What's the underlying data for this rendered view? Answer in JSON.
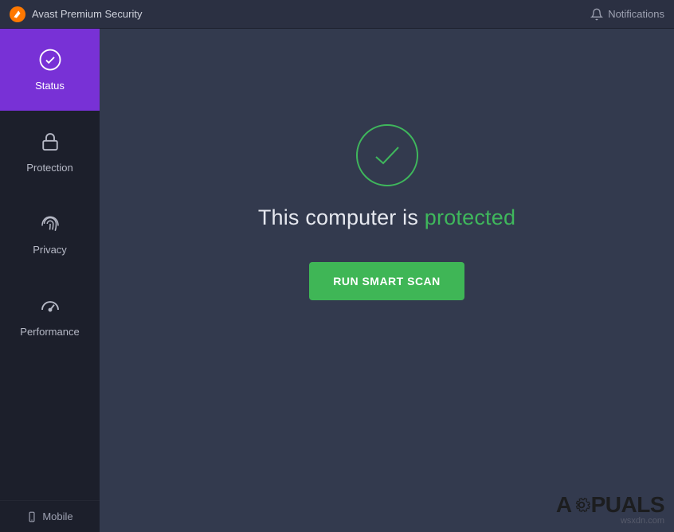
{
  "titlebar": {
    "app_title": "Avast Premium Security",
    "notifications_label": "Notifications"
  },
  "sidebar": {
    "items": [
      {
        "label": "Status",
        "active": true
      },
      {
        "label": "Protection",
        "active": false
      },
      {
        "label": "Privacy",
        "active": false
      },
      {
        "label": "Performance",
        "active": false
      }
    ],
    "footer_label": "Mobile"
  },
  "status": {
    "text_prefix": "This computer is ",
    "text_highlight": "protected",
    "scan_button_label": "RUN SMART SCAN"
  },
  "watermark": {
    "brand_prefix": "A",
    "brand_suffix": "PUALS",
    "url": "wsxdn.com"
  },
  "colors": {
    "accent": "#7831d6",
    "success": "#3fb75c",
    "brand_orange": "#FF7800"
  }
}
